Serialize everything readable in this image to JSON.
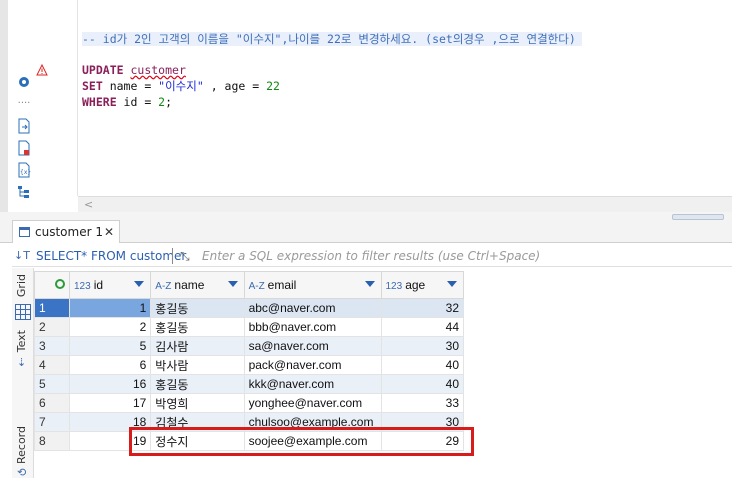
{
  "editor": {
    "comment": "-- id가 2인 고객의 이름을 \"이수지\",나이를 22로 변경하세요. (set의경우 ,으로 연결한다)",
    "line1_kw": "UPDATE",
    "line1_table": "customer",
    "line2_kw": "SET",
    "line2_a": " name = ",
    "line2_str": "\"이수지\"",
    "line2_b": " , age = ",
    "line2_num": "22",
    "line3_kw": "WHERE",
    "line3_a": " id = ",
    "line3_num": "2",
    "line3_end": ";",
    "hscroll_arrow": "<"
  },
  "results_tab": {
    "label": "customer 1",
    "close": "✕"
  },
  "filter": {
    "query": "SELECT* FROM customer",
    "placeholder": "Enter a SQL expression to filter results (use Ctrl+Space)"
  },
  "side_tabs": {
    "grid": "Grid",
    "text": "Text",
    "record": "Record"
  },
  "columns": [
    {
      "type": "123",
      "name": "id"
    },
    {
      "type": "A-Z",
      "name": "name"
    },
    {
      "type": "A-Z",
      "name": "email"
    },
    {
      "type": "123",
      "name": "age"
    }
  ],
  "rows": [
    {
      "n": "1",
      "id": "1",
      "name": "홍길동",
      "email": "abc@naver.com",
      "age": "32"
    },
    {
      "n": "2",
      "id": "2",
      "name": "홍길동",
      "email": "bbb@naver.com",
      "age": "44"
    },
    {
      "n": "3",
      "id": "5",
      "name": "김사람",
      "email": "sa@naver.com",
      "age": "30"
    },
    {
      "n": "4",
      "id": "6",
      "name": "박사람",
      "email": "pack@naver.com",
      "age": "40"
    },
    {
      "n": "5",
      "id": "16",
      "name": "홍길동",
      "email": "kkk@naver.com",
      "age": "40"
    },
    {
      "n": "6",
      "id": "17",
      "name": "박영희",
      "email": "yonghee@naver.com",
      "age": "33"
    },
    {
      "n": "7",
      "id": "18",
      "name": "김철수",
      "email": "chulsoo@example.com",
      "age": "30"
    },
    {
      "n": "8",
      "id": "19",
      "name": "정수지",
      "email": "soojee@example.com",
      "age": "29"
    }
  ],
  "colors": {
    "highlight_box": "#d81c1c",
    "selected_row": "#3b74c4"
  }
}
